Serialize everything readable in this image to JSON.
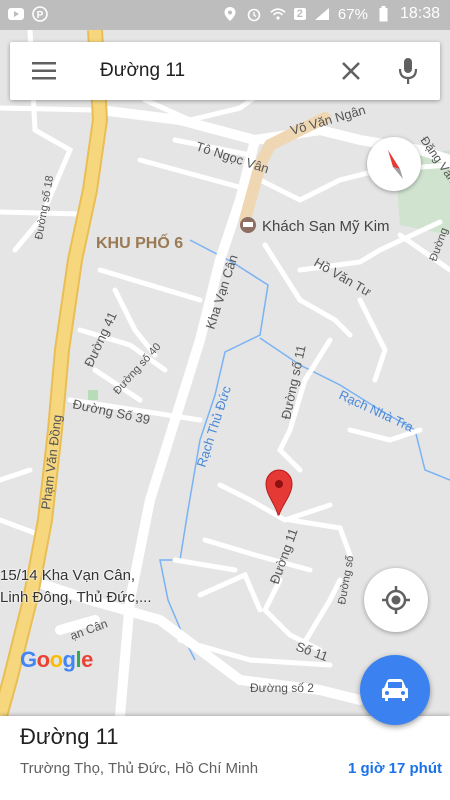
{
  "status_bar": {
    "battery": "67%",
    "time": "18:38",
    "sim_slot": "2"
  },
  "search": {
    "query": "Đường 11"
  },
  "map": {
    "labels": {
      "khu_pho": "KHU PHỐ 6",
      "hotel": "Khách Sạn Mỹ Kim",
      "to_ngoc_van": "Tô Ngọc Vân",
      "vo_van_ngan": "Võ Văn Ngân",
      "dang_van": "Đặng Văn",
      "duong_so_18": "Đường số 18",
      "kha_van_can": "Kha Vạn Cân",
      "ho_van_tu": "Hồ Văn Tư",
      "duong_41": "Đường 41",
      "duong_so_40": "Đường số 40",
      "duong_so_39": "Đường Số 39",
      "pham_van_dong": "Phạm Văn Đồng",
      "rach_thu_duc": "Rạch Thủ Đức",
      "duong_so_11": "Đường số 11",
      "rach_nha_tra": "Rạch Nhà Tra",
      "duong_11": "Đường 11",
      "so_11": "Số 11",
      "duong_so_2": "Đường số 2",
      "an_can": "ạn Cân",
      "duong_so_right": "Đường số",
      "duong_so_far": "Đường"
    },
    "address_line1": "15/14 Kha Vạn Cân,",
    "address_line2": "Linh Đông, Thủ Đức,...",
    "google": [
      "G",
      "o",
      "o",
      "g",
      "l",
      "e"
    ],
    "google_colors": [
      "#4285F4",
      "#EA4335",
      "#FBBC05",
      "#4285F4",
      "#34A853",
      "#EA4335"
    ]
  },
  "place": {
    "title": "Đường 11",
    "address": "Trường Thọ, Thủ Đức, Hồ Chí Minh",
    "travel_time": "1 giờ 17 phút"
  },
  "colors": {
    "accent": "#3b82f0",
    "pin": "#e53935",
    "highway": "#f6d77e"
  }
}
